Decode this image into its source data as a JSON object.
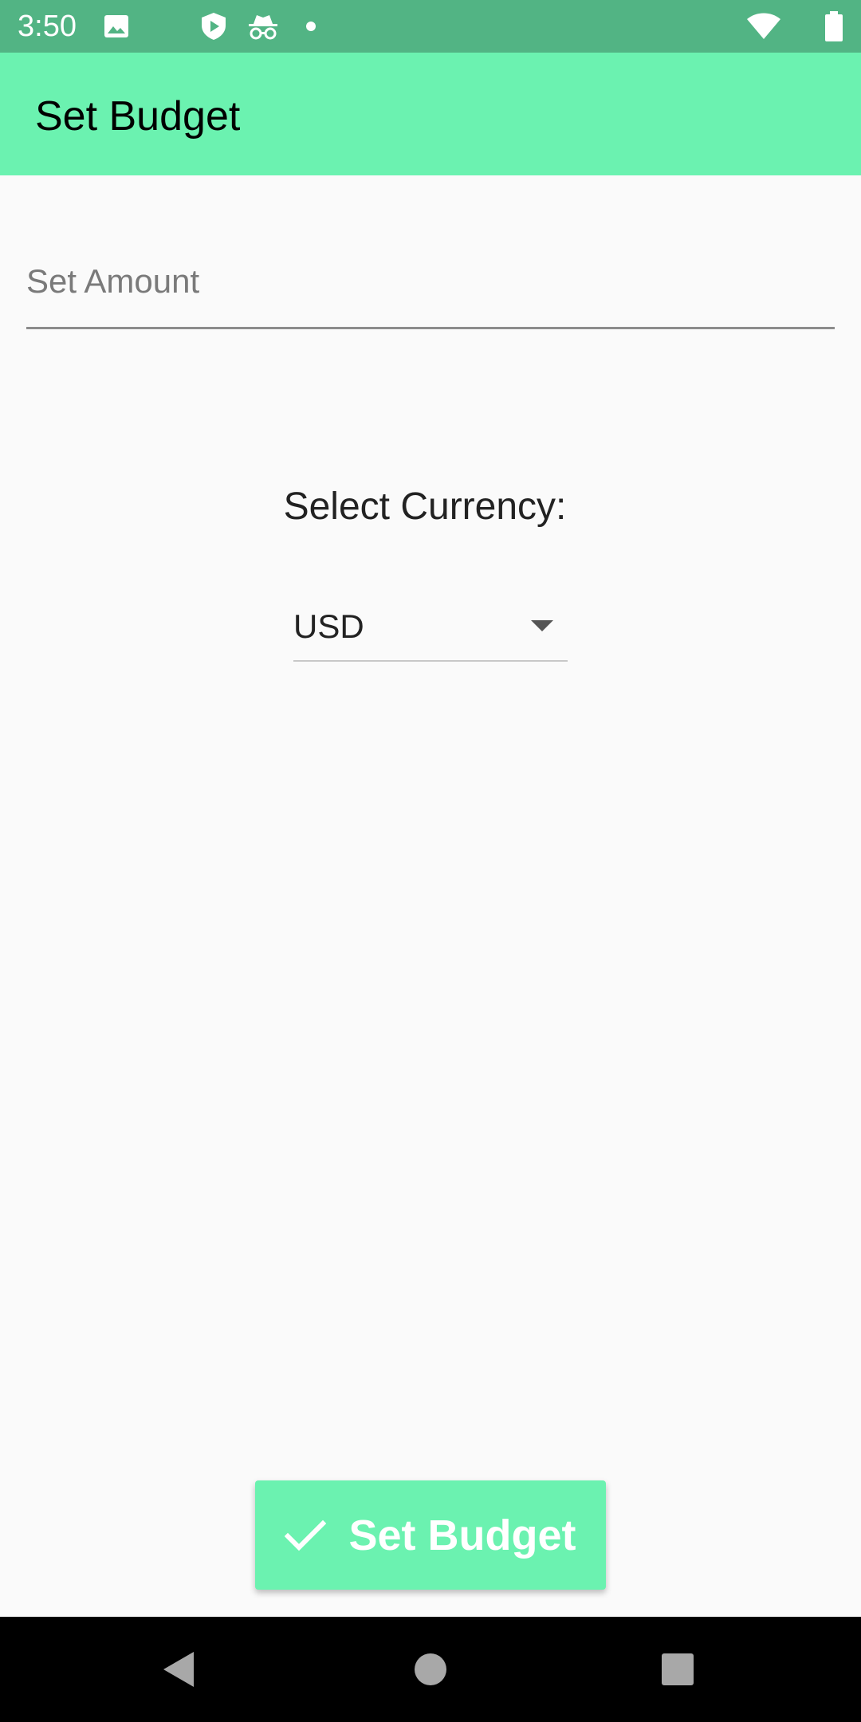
{
  "status_bar": {
    "time": "3:50",
    "icons": [
      "image-icon",
      "shield-play-icon",
      "incognito-icon",
      "dot-icon",
      "wifi-icon",
      "battery-icon"
    ]
  },
  "app_bar": {
    "title": "Set Budget"
  },
  "amount": {
    "placeholder": "Set Amount",
    "value": ""
  },
  "currency": {
    "label": "Select Currency:",
    "selected": "USD"
  },
  "action_button": {
    "label": "Set Budget",
    "icon": "check-icon"
  },
  "nav_bar": {
    "icons": [
      "back-icon",
      "home-icon",
      "recents-icon"
    ]
  },
  "colors": {
    "status_bar": "#52b484",
    "accent": "#6bf2b0",
    "background": "#fafafa"
  }
}
